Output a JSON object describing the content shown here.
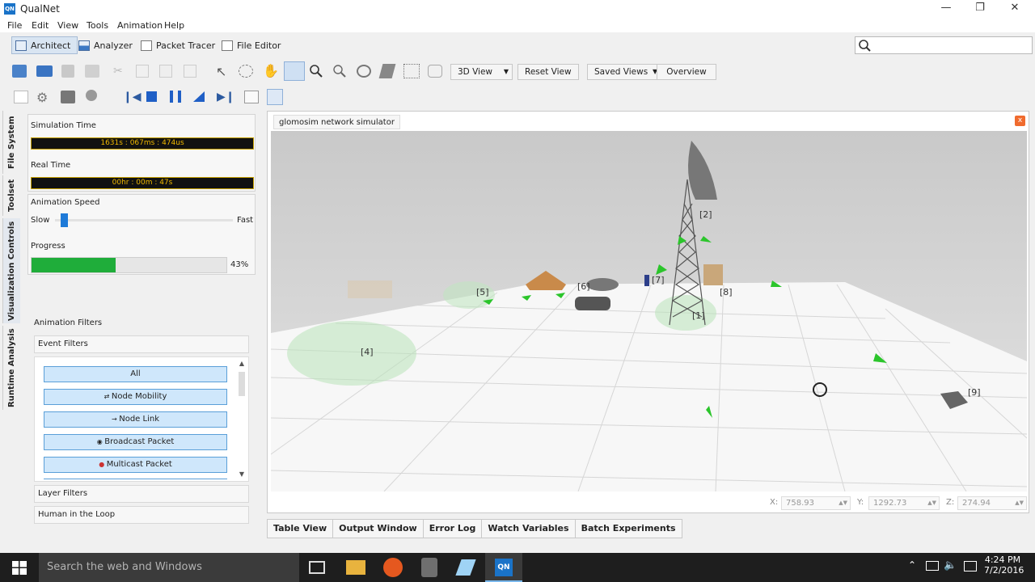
{
  "window": {
    "title": "QualNet",
    "icon_text": "QN",
    "minimize_icon": "minimize-icon",
    "restore_icon": "restore-icon",
    "close_icon": "close-icon"
  },
  "menu": [
    "File",
    "Edit",
    "View",
    "Tools",
    "Animation",
    "Help"
  ],
  "perspectives": [
    {
      "label": "Architect",
      "icon": "architect-icon",
      "active": true
    },
    {
      "label": "Analyzer",
      "icon": "analyzer-icon",
      "active": false
    },
    {
      "label": "Packet Tracer",
      "icon": "packet-tracer-icon",
      "active": false
    },
    {
      "label": "File Editor",
      "icon": "file-editor-icon",
      "active": false
    }
  ],
  "search": {
    "placeholder": "",
    "icon": "search-icon"
  },
  "toolbar": {
    "view_select": "3D View",
    "reset_view": "Reset View",
    "saved_views": "Saved Views",
    "overview": "Overview"
  },
  "side_tabs": [
    "File System",
    "Toolset",
    "Visualization Controls",
    "Runtime Analysis"
  ],
  "controls": {
    "sim_time_label": "Simulation Time",
    "sim_time_value": "1631s : 067ms : 474us",
    "real_time_label": "Real Time",
    "real_time_value": "00hr : 00m : 47s",
    "anim_speed_label": "Animation Speed",
    "slow_label": "Slow",
    "fast_label": "Fast",
    "anim_speed_level": 0.03,
    "progress_label": "Progress",
    "progress_value": "43%",
    "progress_fraction": 0.43
  },
  "filters": {
    "animation_filters_label": "Animation Filters",
    "event_filters_label": "Event Filters",
    "buttons": [
      "All",
      "Node Mobility",
      "Node Link",
      "Broadcast Packet",
      "Multicast Packet"
    ],
    "layer_filters_label": "Layer Filters",
    "human_loop_label": "Human in the Loop"
  },
  "viewport": {
    "tab_title": "glomosim network simulator",
    "close_icon": "x",
    "node_labels": [
      "[1]",
      "[2]",
      "[4]",
      "[5]",
      "[6]",
      "[7]",
      "[8]",
      "[9]"
    ]
  },
  "coords": {
    "x_label": "X:",
    "x_value": "758.93",
    "y_label": "Y:",
    "y_value": "1292.73",
    "z_label": "Z:",
    "z_value": "274.94"
  },
  "bottom_tabs": [
    "Table View",
    "Output Window",
    "Error Log",
    "Watch Variables",
    "Batch Experiments"
  ],
  "taskbar": {
    "search_placeholder": "Search the web and Windows",
    "time": "4:24 PM",
    "date": "7/2/2016",
    "qualnet_icon_text": "QN"
  }
}
